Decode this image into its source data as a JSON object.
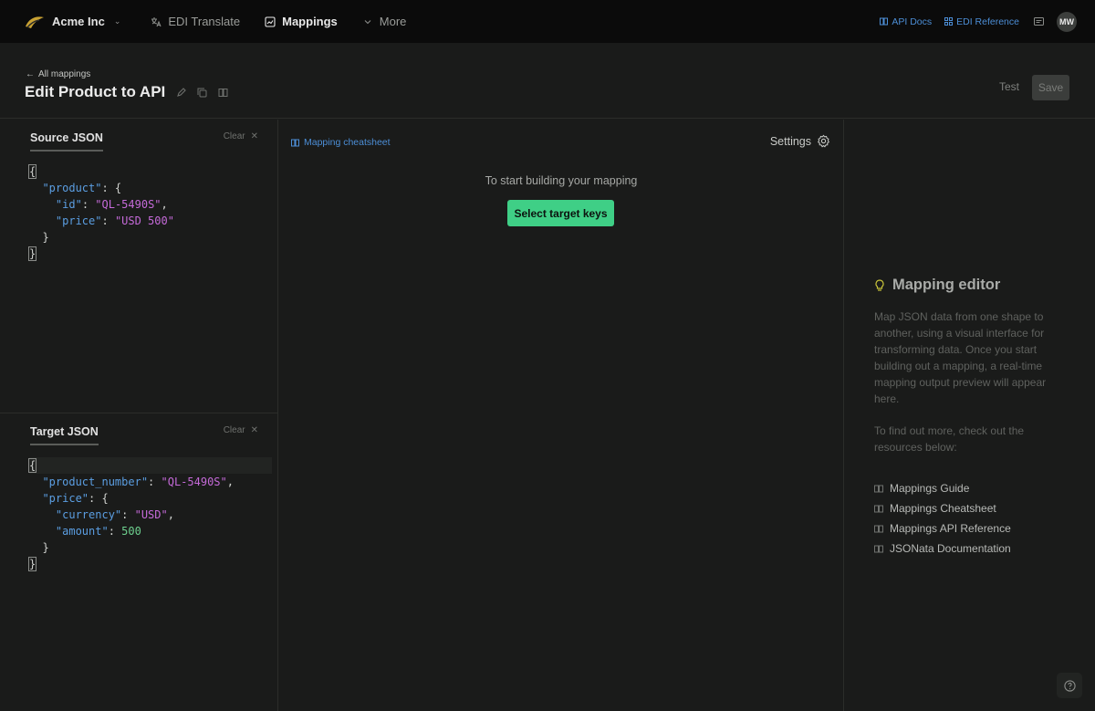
{
  "topbar": {
    "org_name": "Acme Inc",
    "nav": [
      {
        "label": "EDI Translate",
        "icon": "translate-icon"
      },
      {
        "label": "Mappings",
        "icon": "mappings-icon",
        "active": true
      },
      {
        "label": "More",
        "icon": "chevron-down-icon"
      }
    ],
    "api_docs": "API Docs",
    "edi_reference": "EDI Reference",
    "avatar_initials": "MW"
  },
  "header": {
    "back_label": "All mappings",
    "title": "Edit Product to API",
    "test_label": "Test",
    "save_label": "Save"
  },
  "source": {
    "tab": "Source JSON",
    "clear": "Clear",
    "lines": [
      [
        "{"
      ],
      [
        "  ",
        {
          "k": "\"product\""
        },
        ": {"
      ],
      [
        "    ",
        {
          "k": "\"id\""
        },
        ": ",
        {
          "s": "\"QL-5490S\""
        },
        ","
      ],
      [
        "    ",
        {
          "k": "\"price\""
        },
        ": ",
        {
          "s": "\"USD 500\""
        }
      ],
      [
        "  }"
      ],
      [
        "}"
      ]
    ]
  },
  "target": {
    "tab": "Target JSON",
    "clear": "Clear",
    "lines": [
      [
        "{"
      ],
      [
        "  ",
        {
          "k": "\"product_number\""
        },
        ": ",
        {
          "s": "\"QL-5490S\""
        },
        ","
      ],
      [
        "  ",
        {
          "k": "\"price\""
        },
        ": {"
      ],
      [
        "    ",
        {
          "k": "\"currency\""
        },
        ": ",
        {
          "s": "\"USD\""
        },
        ","
      ],
      [
        "    ",
        {
          "k": "\"amount\""
        },
        ": ",
        {
          "n": "500"
        }
      ],
      [
        "  }"
      ],
      [
        "}"
      ]
    ]
  },
  "middle": {
    "cheatsheet_link": "Mapping cheatsheet",
    "settings": "Settings",
    "start_text": "To start building your mapping",
    "select_button": "Select target keys"
  },
  "help": {
    "title": "Mapping editor",
    "description": "Map JSON data from one shape to another, using a visual interface for transforming data. Once you start building out a mapping, a real-time mapping output preview will appear here.",
    "description2": "To find out more, check out the resources below:",
    "resources": [
      "Mappings Guide",
      "Mappings Cheatsheet",
      "Mappings API Reference",
      "JSONata Documentation"
    ]
  },
  "colors": {
    "accent_green": "#3fcf86",
    "link_blue": "#4c8ed6",
    "json_key": "#5b9ee2",
    "json_string": "#c56ad9",
    "json_number": "#6ed18f"
  }
}
